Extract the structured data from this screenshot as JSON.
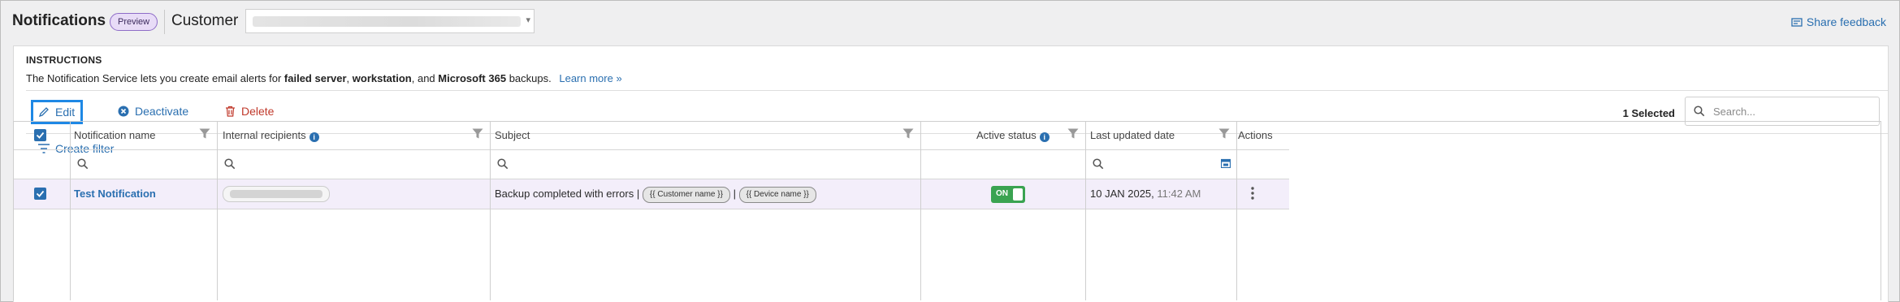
{
  "header": {
    "title": "Notifications",
    "badge": "Preview",
    "customer_label": "Customer",
    "share_feedback": "Share feedback"
  },
  "instructions": {
    "heading": "INSTRUCTIONS",
    "text_1": "The Notification Service lets you create email alerts for ",
    "bold_1": "failed server",
    "text_2": ", ",
    "bold_2": "workstation",
    "text_3": ", and ",
    "bold_3": "Microsoft 365",
    "text_4": " backups.",
    "learn_more": "Learn more »"
  },
  "toolbar": {
    "edit": "Edit",
    "deactivate": "Deactivate",
    "delete": "Delete",
    "selected": "1 Selected",
    "search_placeholder": "Search..."
  },
  "filter": {
    "create_filter": "Create filter"
  },
  "table": {
    "columns": {
      "name": "Notification name",
      "recipients": "Internal recipients",
      "subject": "Subject",
      "active": "Active status",
      "updated": "Last updated date",
      "actions": "Actions"
    },
    "rows": [
      {
        "name": "Test Notification",
        "subject_text": "Backup completed with errors",
        "separator": "|",
        "tag_customer": "{{ Customer name }}",
        "tag_device": "{{ Device name }}",
        "status": "ON",
        "date": "10 JAN 2025,",
        "time": "11:42 AM",
        "selected": true
      }
    ]
  },
  "colors": {
    "accent": "#2a6fb0",
    "focus": "#1e88e5",
    "danger": "#c0392b",
    "on": "#3aa351",
    "selected_row": "#f3eefa",
    "badge_bg": "#e8dcf7"
  },
  "icons": [
    "feedback-icon",
    "pencil-icon",
    "deactivate-icon",
    "trash-icon",
    "search-icon",
    "filter-lines-icon",
    "funnel-icon",
    "info-icon",
    "checkbox-checked-icon",
    "calendar-icon",
    "kebab-icon",
    "chevron-down-icon"
  ]
}
